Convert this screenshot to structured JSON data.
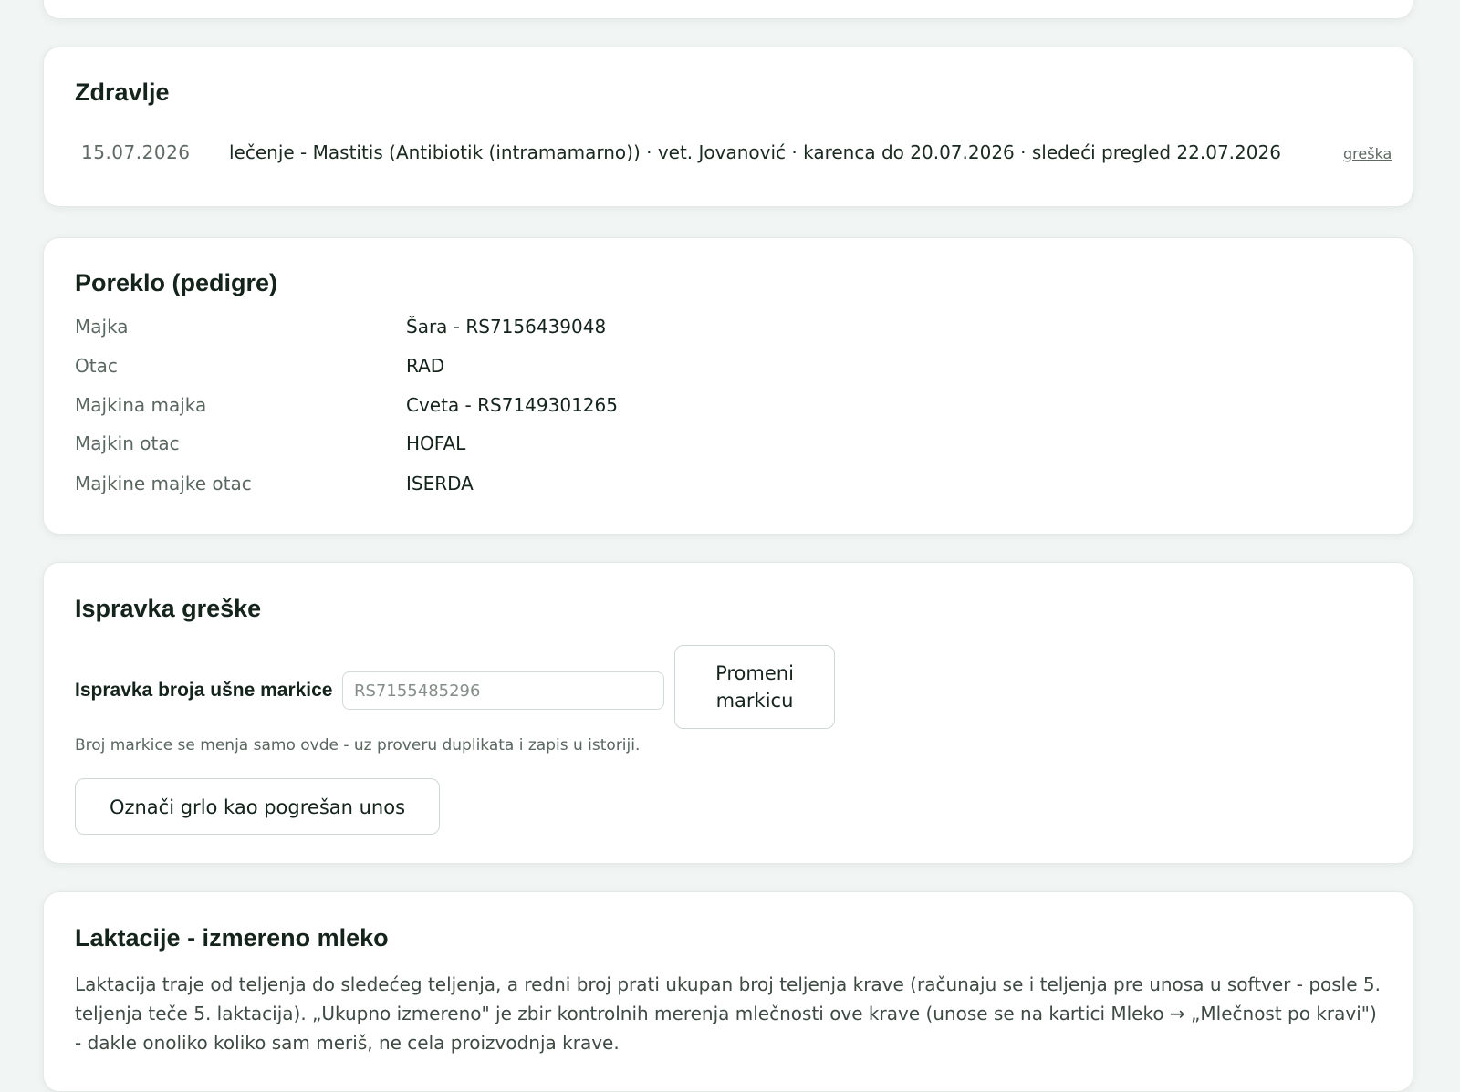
{
  "health": {
    "title": "Zdravlje",
    "entries": [
      {
        "date": "15.07.2026",
        "description": "lečenje - Mastitis (Antibiotik (intramamarno)) · vet. Jovanović · karenca do 20.07.2026 · sledeći pregled 22.07.2026",
        "link": "greška"
      }
    ]
  },
  "pedigree": {
    "title": "Poreklo (pedigre)",
    "rows": [
      {
        "label": "Majka",
        "value": "Šara - RS7156439048"
      },
      {
        "label": "Otac",
        "value": "RAD"
      },
      {
        "label": "Majkina majka",
        "value": "Cveta - RS7149301265"
      },
      {
        "label": "Majkin otac",
        "value": "HOFAL"
      },
      {
        "label": "Majkine majke otac",
        "value": "ISERDA"
      }
    ]
  },
  "correction": {
    "title": "Ispravka greške",
    "field_label": "Ispravka broja ušne markice",
    "input_placeholder": "RS7155485296",
    "change_button": "Promeni markicu",
    "help_text": "Broj markice se menja samo ovde - uz proveru duplikata i zapis u istoriji.",
    "mark_button": "Označi grlo kao pogrešan unos"
  },
  "lactation": {
    "title": "Laktacije - izmereno mleko",
    "description": "Laktacija traje od teljenja do sledećeg teljenja, a redni broj prati ukupan broj teljenja krave (računaju se i teljenja pre unosa u softver - posle 5. teljenja teče 5. laktacija). „Ukupno izmereno\" je zbir kontrolnih merenja mlečnosti ove krave (unose se na kartici Mleko → „Mlečnost po kravi\") - dakle onoliko koliko sam meriš, ne cela proizvodnja krave."
  }
}
